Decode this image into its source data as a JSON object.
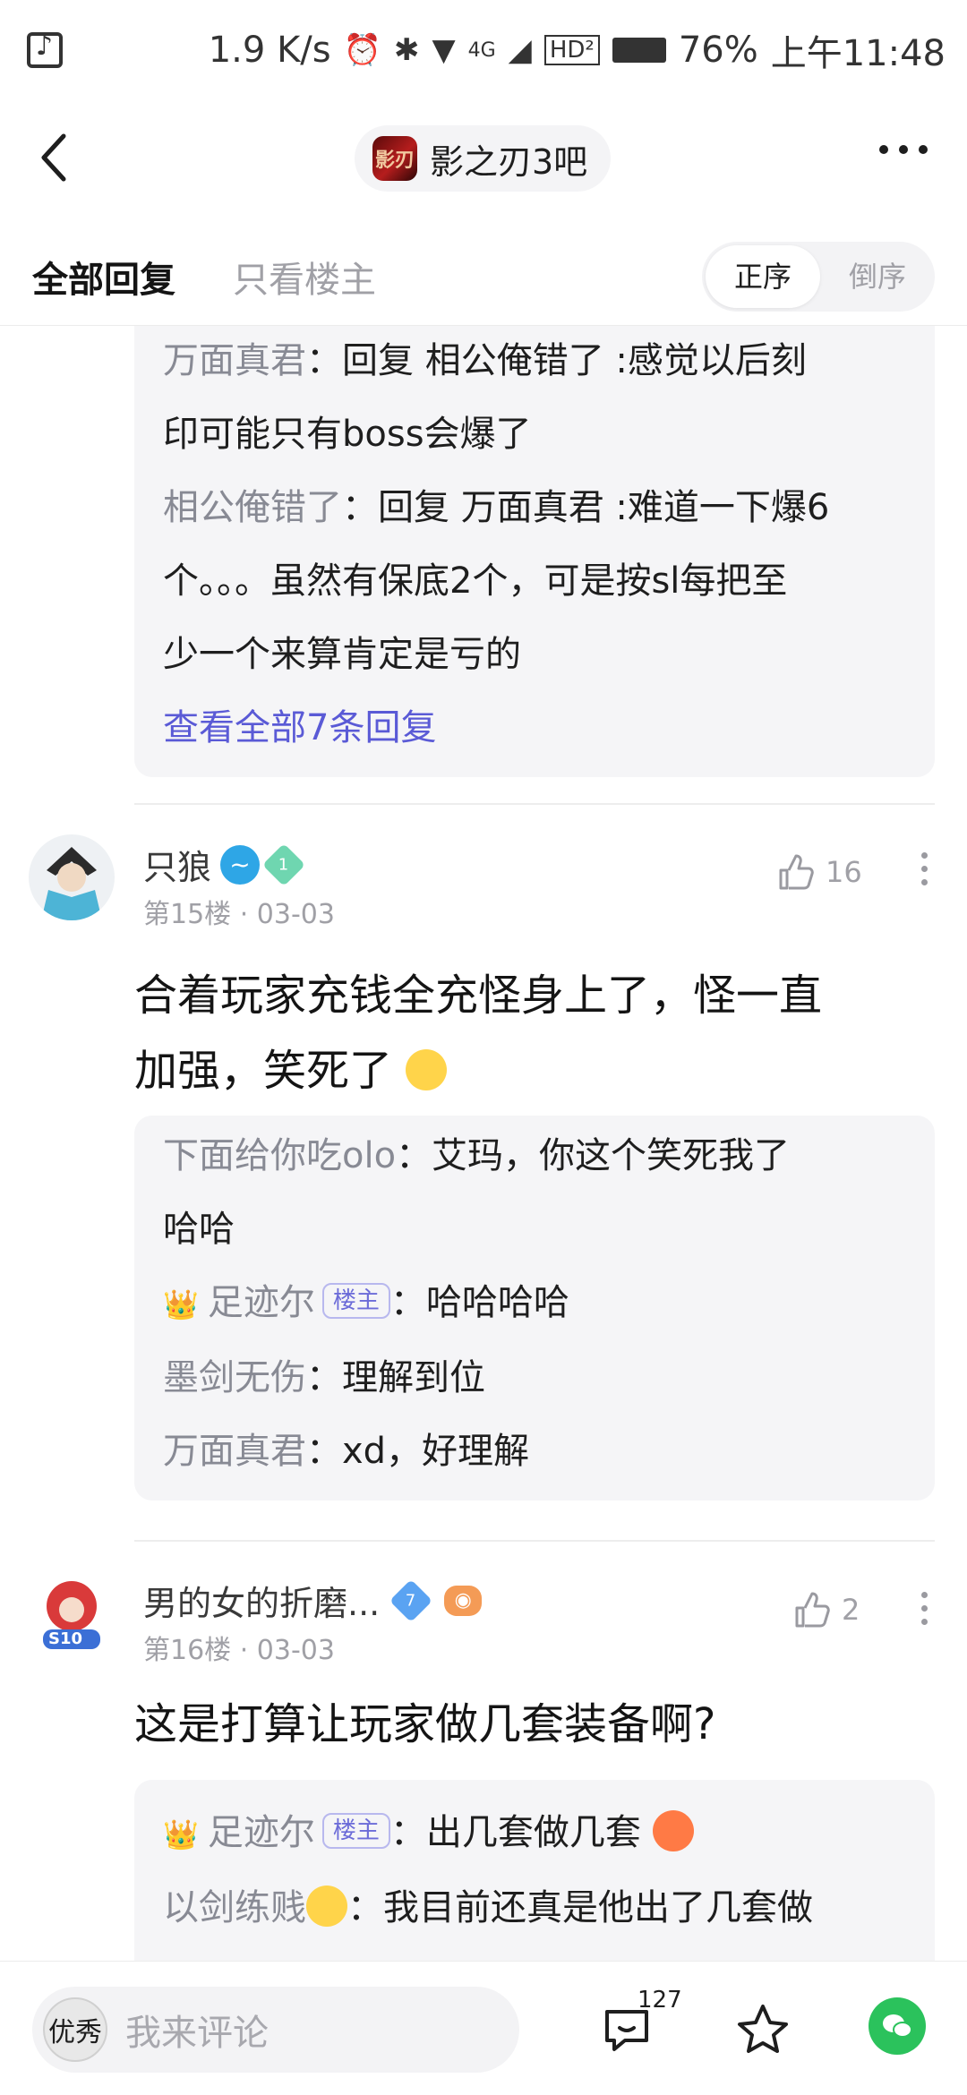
{
  "status_bar": {
    "speed": "1.9 K/s",
    "network": "4G",
    "hd": "HD²",
    "battery": "76%",
    "time": "上午11:48"
  },
  "nav": {
    "forum_avatar_text": "影刃",
    "forum_name": "影之刃3吧"
  },
  "filter": {
    "tab_all": "全部回复",
    "tab_op_only": "只看楼主",
    "sort_asc": "正序",
    "sort_desc": "倒序"
  },
  "thread_prev": {
    "replies": [
      {
        "name": "万面真君",
        "text": "：回复 相公俺错了 :感觉以后刻",
        "cont": "印可能只有boss会爆了"
      },
      {
        "name": "相公俺错了",
        "text": "：回复 万面真君 :难道一下爆6",
        "cont1": "个。。。虽然有保底2个，可是按sl每把至",
        "cont2": "少一个来算肯定是亏的"
      }
    ],
    "see_all": "查看全部7条回复"
  },
  "post15": {
    "username": "只狼",
    "level": "1",
    "floor": "第15楼",
    "date": "03-03",
    "likes": "16",
    "line1": "合着玩家充钱全充怪身上了，怪一直",
    "line2": "加强，笑死了",
    "replies": {
      "r1_name": "下面给你吃olo",
      "r1_text": "：艾玛，你这个笑死我了",
      "r1_cont": "哈哈",
      "r2_name": "足迹尔",
      "r2_tag": "楼主",
      "r2_text": "：哈哈哈哈",
      "r3_name": "墨剑无伤",
      "r3_text": "：理解到位",
      "r4_name": "万面真君",
      "r4_text": "：xd，好理解"
    }
  },
  "post16": {
    "username": "男的女的折磨...",
    "level": "7",
    "floor": "第16楼",
    "date": "03-03",
    "likes": "2",
    "avatar_badge": "S10",
    "line1": "这是打算让玩家做几套装备啊?",
    "replies": {
      "r1_name": "足迹尔",
      "r1_tag": "楼主",
      "r1_text": "：出几套做几套",
      "r2_name": "以剑练贱",
      "r2_text": "：我目前还真是他出了几套做"
    }
  },
  "bottom_bar": {
    "me_avatar_text": "优秀",
    "placeholder": "我来评论",
    "comment_count": "127"
  },
  "colors": {
    "accent_link": "#5a5ad6",
    "reply_bg": "#f5f5f7",
    "wechat_green": "#2bc25c"
  }
}
